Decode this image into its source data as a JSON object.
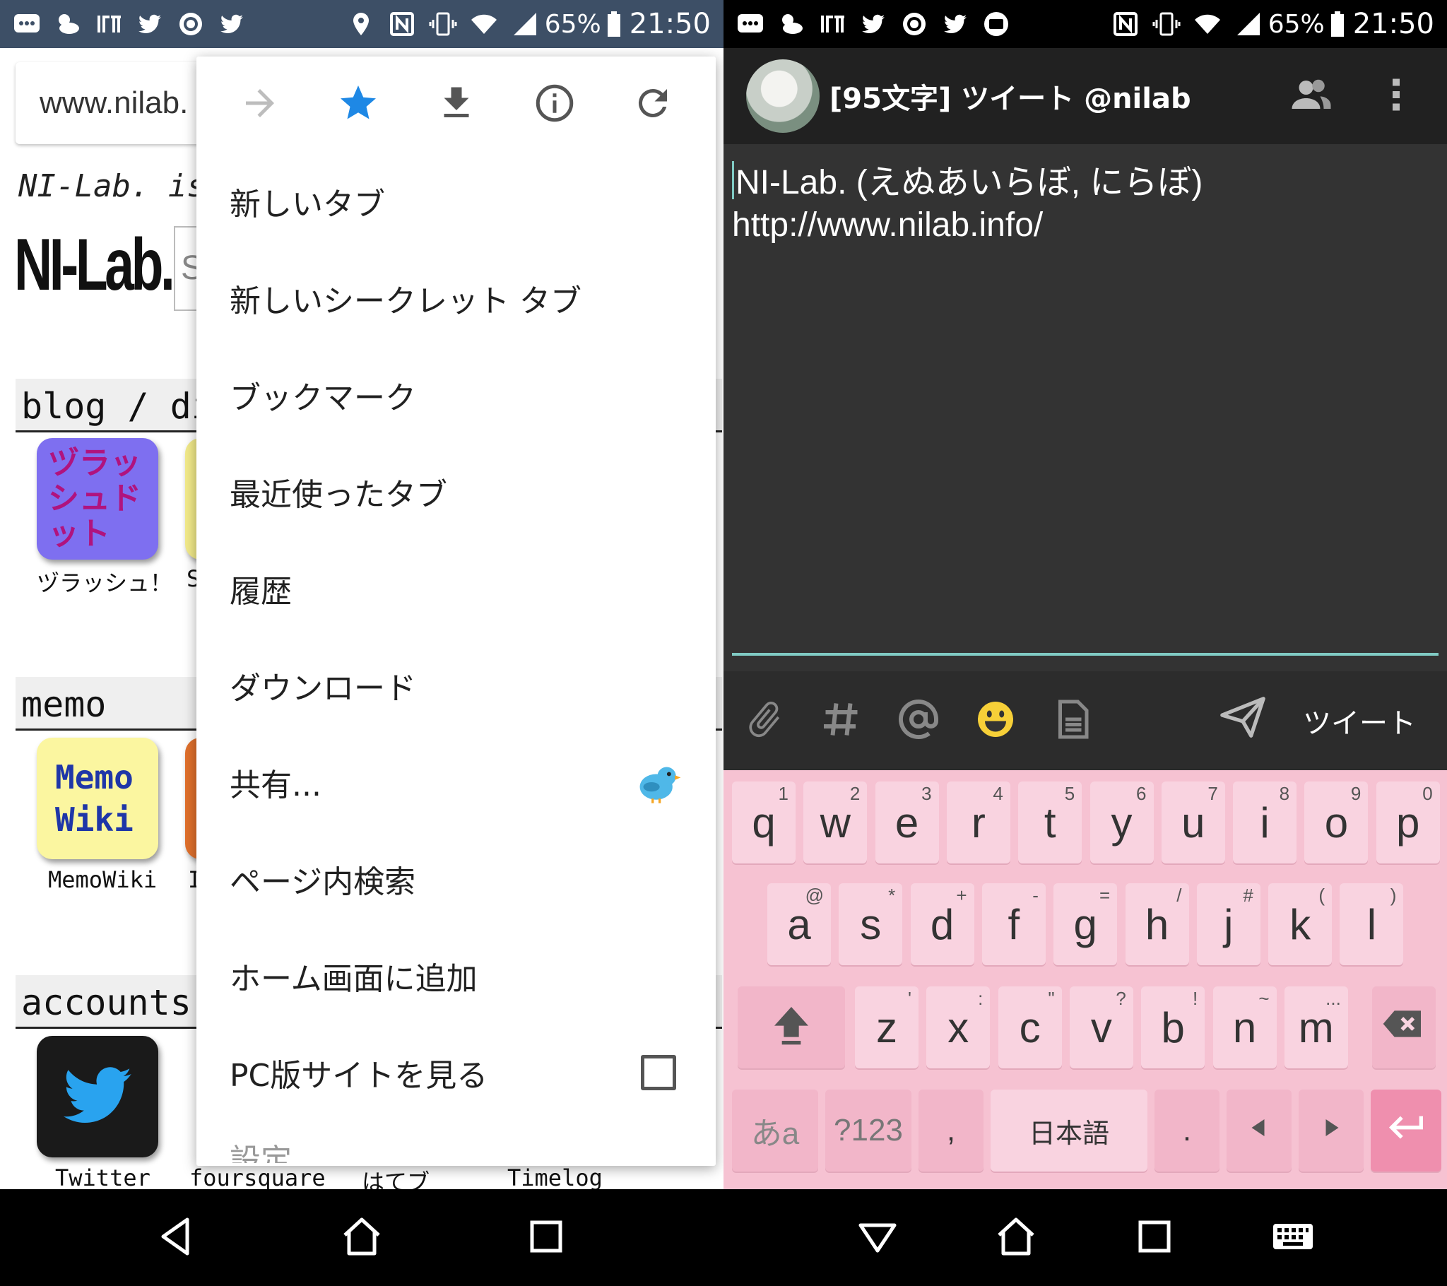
{
  "left": {
    "status": {
      "battery": "65%",
      "time": "21:50"
    },
    "page": {
      "url": "www.nilab.",
      "tagline": "NI-Lab.  is",
      "logo": "NI-Lab.",
      "search_hint": "S",
      "sections": [
        {
          "heading": "blog / di"
        },
        {
          "heading": "memo"
        },
        {
          "heading": "accounts"
        }
      ],
      "apps": {
        "tsurasshu": {
          "label": "ヅラッシュ！",
          "tile_text": "ヅラッシュドット"
        },
        "s_cut": {
          "label": "S"
        },
        "memowiki": {
          "label": "MemoWiki",
          "tile_text": "Memo Wiki"
        },
        "i_cut": {
          "label": "I"
        },
        "twitter": {
          "label": "Twitter"
        },
        "foursquare": {
          "label": "foursquare"
        },
        "hatebu": {
          "label": "はてブ"
        },
        "timelog": {
          "label": "Timelog"
        }
      }
    },
    "menu": {
      "items": [
        {
          "label": "新しいタブ"
        },
        {
          "label": "新しいシークレット タブ"
        },
        {
          "label": "ブックマーク"
        },
        {
          "label": "最近使ったタブ"
        },
        {
          "label": "履歴"
        },
        {
          "label": "ダウンロード"
        },
        {
          "label": "共有..."
        },
        {
          "label": "ページ内検索"
        },
        {
          "label": "ホーム画面に追加"
        },
        {
          "label": "PC版サイトを見る"
        },
        {
          "label": "設定"
        }
      ]
    }
  },
  "right": {
    "status": {
      "battery": "65%",
      "time": "21:50"
    },
    "composer": {
      "title": "[95文字] ツイート @nilab",
      "text_line1": "NI-Lab. (えぬあいらぼ, にらぼ)",
      "text_line2": "http://www.nilab.info/",
      "send_label": "ツイート"
    },
    "keyboard": {
      "row1": [
        {
          "k": "q",
          "h": "1"
        },
        {
          "k": "w",
          "h": "2"
        },
        {
          "k": "e",
          "h": "3"
        },
        {
          "k": "r",
          "h": "4"
        },
        {
          "k": "t",
          "h": "5"
        },
        {
          "k": "y",
          "h": "6"
        },
        {
          "k": "u",
          "h": "7"
        },
        {
          "k": "i",
          "h": "8"
        },
        {
          "k": "o",
          "h": "9"
        },
        {
          "k": "p",
          "h": "0"
        }
      ],
      "row2": [
        {
          "k": "a",
          "h": "@"
        },
        {
          "k": "s",
          "h": "*"
        },
        {
          "k": "d",
          "h": "+"
        },
        {
          "k": "f",
          "h": "-"
        },
        {
          "k": "g",
          "h": "="
        },
        {
          "k": "h",
          "h": "/"
        },
        {
          "k": "j",
          "h": "#"
        },
        {
          "k": "k",
          "h": "("
        },
        {
          "k": "l",
          "h": ")"
        }
      ],
      "row3": [
        {
          "k": "z",
          "h": "'"
        },
        {
          "k": "x",
          "h": ":"
        },
        {
          "k": "c",
          "h": "\""
        },
        {
          "k": "v",
          "h": "?"
        },
        {
          "k": "b",
          "h": "!"
        },
        {
          "k": "n",
          "h": "~"
        },
        {
          "k": "m",
          "h": "..."
        }
      ],
      "mode_key": "あa",
      "symbols_key": "?123",
      "comma_key": ",",
      "space_key": "日本語",
      "period_key": "."
    }
  },
  "colors": {
    "accent_blue": "#1e88e5",
    "teal_underline": "#80cbc4",
    "keyboard_pink": "#f6c2d2",
    "enter_pink": "#ef8fae"
  }
}
